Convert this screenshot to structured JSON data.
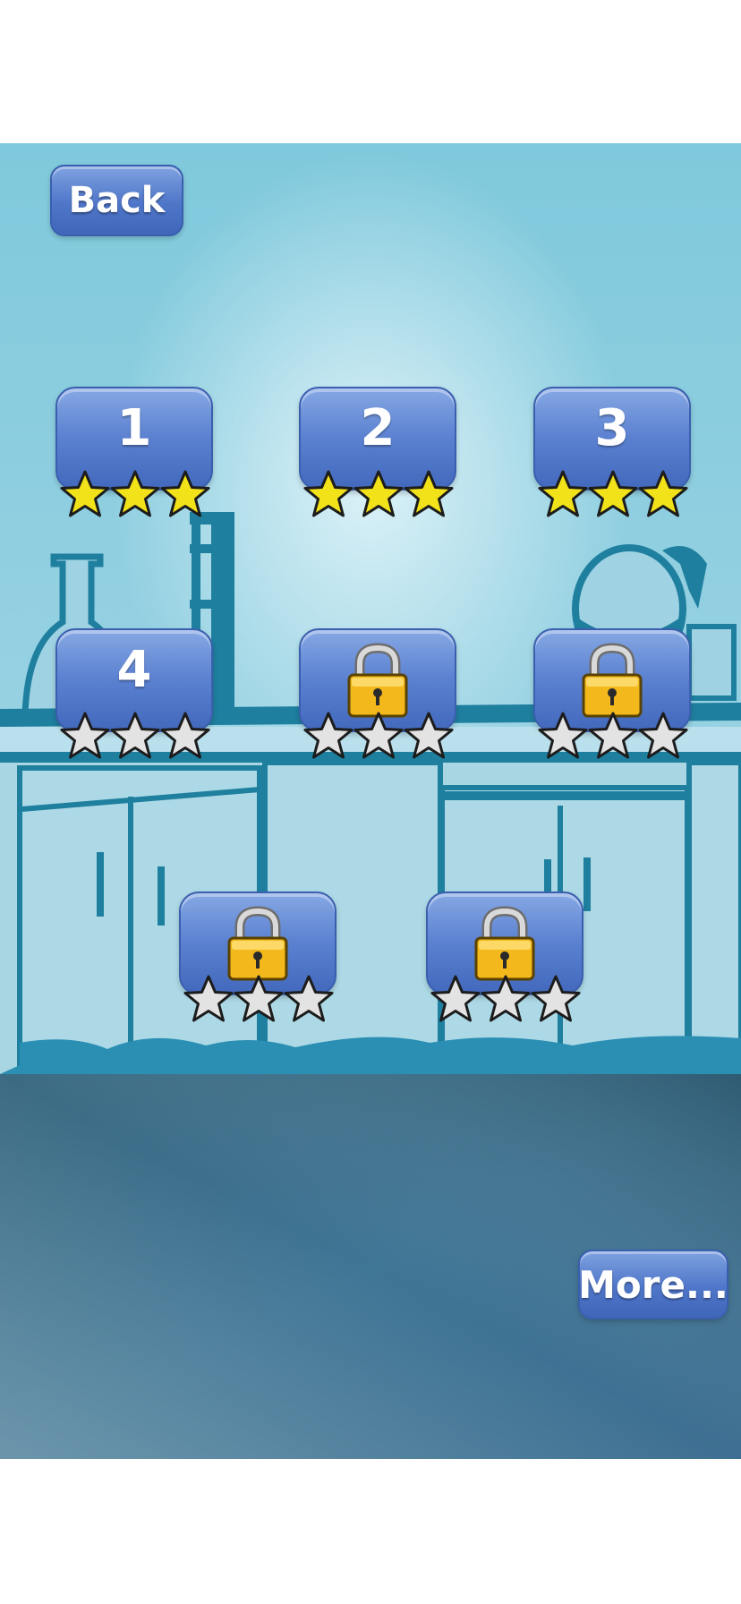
{
  "buttons": {
    "back_label": "Back",
    "more_label": "More..."
  },
  "levels": [
    {
      "number": "1",
      "locked": false,
      "stars_earned": 3,
      "stars_total": 3
    },
    {
      "number": "2",
      "locked": false,
      "stars_earned": 3,
      "stars_total": 3
    },
    {
      "number": "3",
      "locked": false,
      "stars_earned": 3,
      "stars_total": 3
    },
    {
      "number": "4",
      "locked": false,
      "stars_earned": 0,
      "stars_total": 3
    },
    {
      "number": "",
      "locked": true,
      "stars_earned": 0,
      "stars_total": 3
    },
    {
      "number": "",
      "locked": true,
      "stars_earned": 0,
      "stars_total": 3
    },
    {
      "number": "",
      "locked": true,
      "stars_earned": 0,
      "stars_total": 3
    },
    {
      "number": "",
      "locked": true,
      "stars_earned": 0,
      "stars_total": 3
    }
  ],
  "colors": {
    "button_blue": "#4f76c9",
    "star_gold": "#f2e21a",
    "star_empty": "#e3e3e3",
    "lock_gold": "#f2b81c",
    "sky": "#8ccfe0",
    "lab_outline": "#1f7f9f",
    "floor": "#3d6f8c"
  },
  "icons": {
    "earned_star": "star-filled-icon",
    "empty_star": "star-empty-icon",
    "locked": "padlock-icon"
  }
}
